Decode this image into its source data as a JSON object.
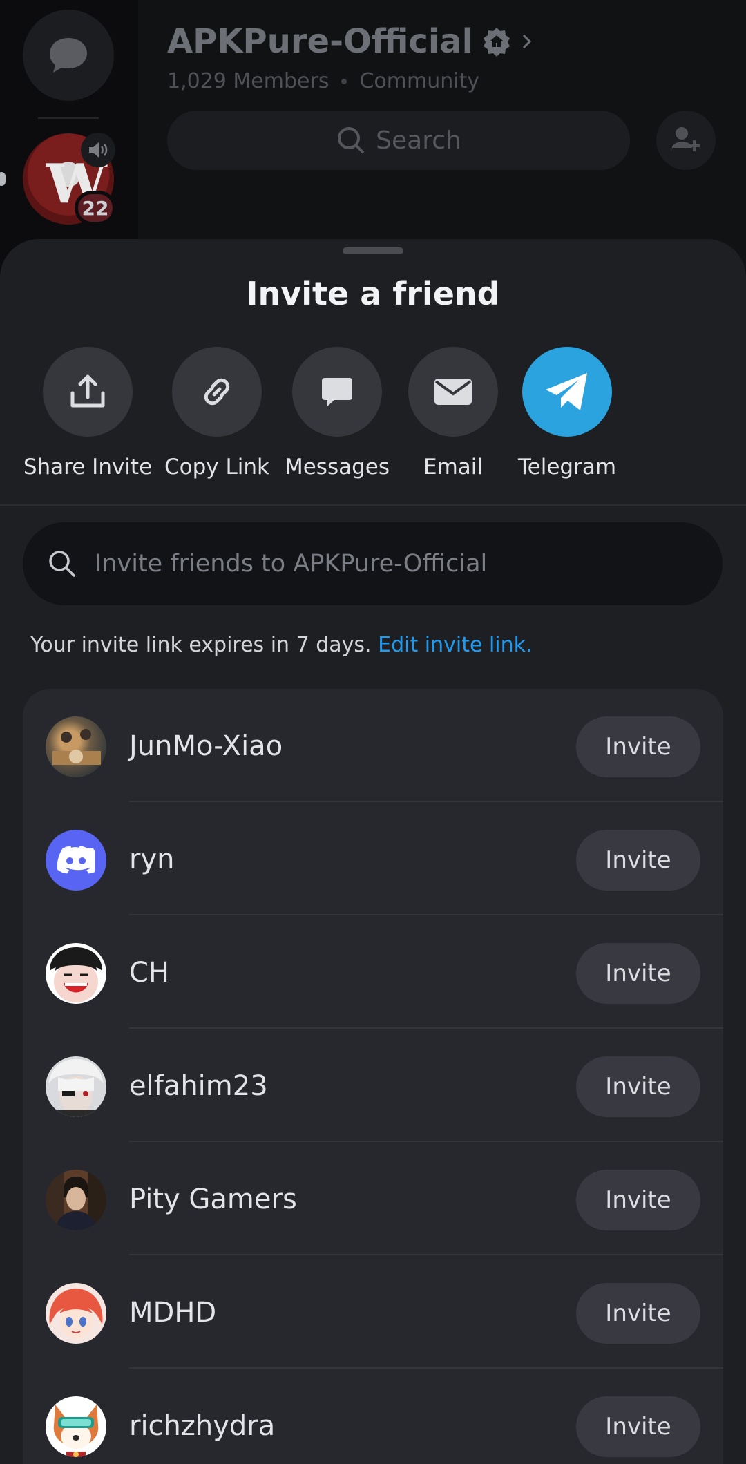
{
  "server": {
    "name": "APKPure-Official",
    "members": "1,029 Members",
    "type": "Community",
    "search_label": "Search",
    "guild_badge_count": "22"
  },
  "sheet": {
    "title": "Invite a friend",
    "share_options": [
      {
        "label": "Share Invite",
        "icon": "share-icon"
      },
      {
        "label": "Copy Link",
        "icon": "link-icon"
      },
      {
        "label": "Messages",
        "icon": "message-icon"
      },
      {
        "label": "Email",
        "icon": "mail-icon"
      },
      {
        "label": "Telegram",
        "icon": "telegram-icon"
      }
    ],
    "search_placeholder": "Invite friends to APKPure-Official",
    "expire_text": "Your invite link expires in 7 days.",
    "edit_link_label": "Edit invite link.",
    "invite_label": "Invite",
    "friends": [
      {
        "name": "JunMo-Xiao"
      },
      {
        "name": "ryn"
      },
      {
        "name": "CH"
      },
      {
        "name": "elfahim23"
      },
      {
        "name": "Pity Gamers"
      },
      {
        "name": "MDHD"
      },
      {
        "name": "richzhydra"
      }
    ]
  },
  "colors": {
    "sheet_bg": "#1e1f23",
    "list_bg": "#27282e",
    "accent_link": "#1e9bf0",
    "telegram": "#2aa3df",
    "discord_blurple": "#5865f2"
  }
}
